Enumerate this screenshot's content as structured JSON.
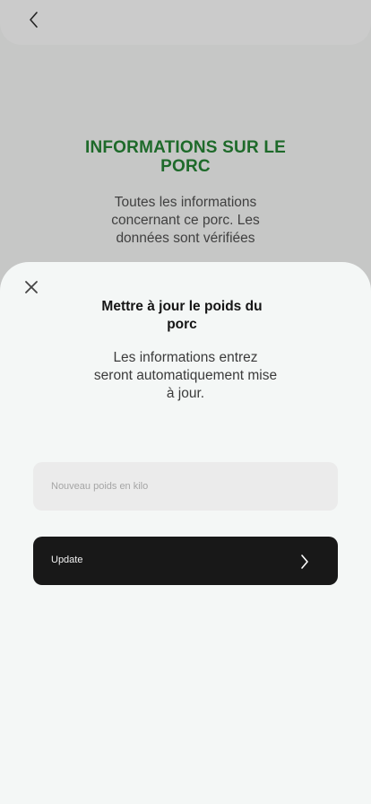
{
  "background": {
    "title": "INFORMATIONS SUR LE PORC",
    "description": "Toutes les informations concernant ce porc. Les données sont vérifiées",
    "back_icon": "chevron-left-icon"
  },
  "sheet": {
    "close_icon": "close-icon",
    "title": "Mettre à jour le poids du porc",
    "description": "Les informations entrez seront automatiquement mise à jour.",
    "input": {
      "placeholder": "Nouveau poids en kilo",
      "value": ""
    },
    "button": {
      "label": "Update",
      "icon": "chevron-right-icon"
    }
  },
  "colors": {
    "title_green": "#1e6a2a",
    "button_dark": "#181818",
    "sheet_bg": "#f4f7f6",
    "overlay_bg": "#c6c7c6"
  }
}
